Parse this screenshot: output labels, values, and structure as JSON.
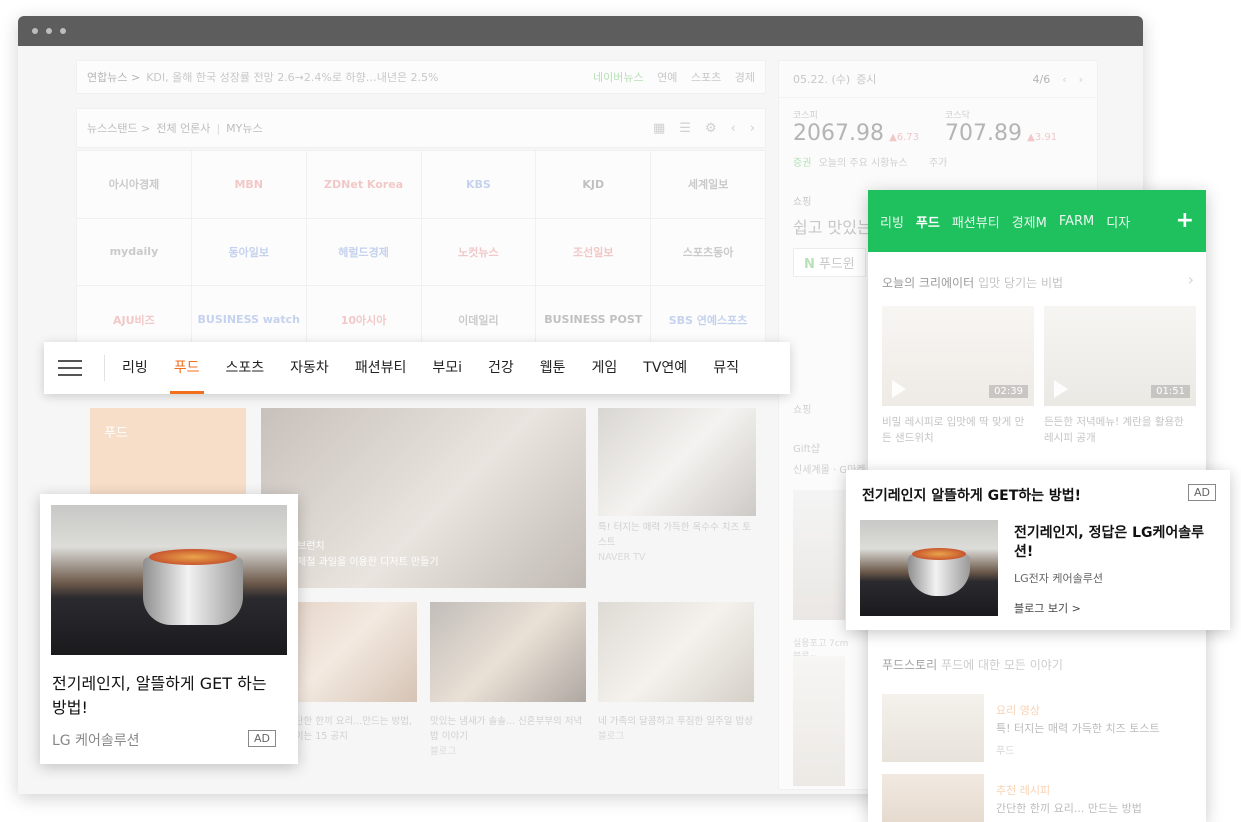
{
  "newsbar": {
    "source": "연합뉴스 >",
    "headline": "KDI, 올해 한국 성장률 전망 2.6→2.4%로 하향…내년은 2.5%",
    "tabs": [
      "네이버뉴스",
      "연예",
      "스포츠",
      "경제"
    ]
  },
  "newsstand": {
    "crumb1": "뉴스스탠드 >",
    "crumb2": "전체 언론사",
    "crumb3": "MY뉴스",
    "publishers": [
      "아시아경제",
      "MBN",
      "ZDNet Korea",
      "KBS",
      "KJD",
      "세계일보",
      "mydaily",
      "동아일보",
      "헤럴드경제",
      "노컷뉴스",
      "조선일보",
      "스포츠동아",
      "AJU비즈",
      "BUSINESS watch",
      "10아시아",
      "이데일리",
      "BUSINESS POST",
      "SBS 연예스포츠"
    ]
  },
  "finance": {
    "date": "05.22. (수)",
    "date_sub": "증시",
    "page": "4/6",
    "kospi_label": "코스피",
    "kospi_value": "2067.98",
    "kospi_change": "▲6.73",
    "kosdaq_label": "코스닥",
    "kosdaq_value": "707.89",
    "kosdaq_change": "▲3.91",
    "news_tag": "증권",
    "news_text": "오늘의 주요 시황뉴스",
    "search_label": "주가"
  },
  "shopping": {
    "label": "쇼핑",
    "title": "쉽고 맛있는",
    "btn_prefix": "N",
    "btn_text": "푸드윈",
    "side_label": "쇼핑",
    "side_lines": [
      "Gift샵",
      "신세계몰 · G마켓"
    ]
  },
  "catnav": {
    "tabs": [
      "리빙",
      "푸드",
      "스포츠",
      "자동차",
      "패션뷰티",
      "부모i",
      "건강",
      "웹툰",
      "게임",
      "TV연예",
      "뮤직"
    ],
    "active_index": 1
  },
  "content": {
    "food_label": "푸드",
    "main_cap1": "브런치",
    "main_cap2": "제철 과일을 이용한 디저트 만들기",
    "r1_title": "특! 터지는 매력 가득한 옥수수 치즈 토스트",
    "r1_src": "NAVER TV",
    "row2": [
      {
        "title": "간단한 한끼 요리...만드는 방법, 모이는 15 공지",
        "src": ""
      },
      {
        "title": "맛있는 냄새가 솔솔... 신혼부부의 저녁밥 이야기",
        "src": "블로그"
      },
      {
        "title": "네 가족의 달콤하고 푸짐한 일주일 밥상",
        "src": "블로그"
      }
    ],
    "narrow_text": "실용포고 7cm 블루~"
  },
  "ad_left": {
    "title": "전기레인지, 알뜰하게 GET 하는 방법!",
    "advertiser": "LG 케어솔루션",
    "badge": "AD"
  },
  "mobile": {
    "tabs": [
      "리빙",
      "푸드",
      "패션뷰티",
      "경제M",
      "FARM",
      "디자"
    ],
    "active_index": 1,
    "plus": "+",
    "creator_title": "오늘의 크리에이터",
    "creator_sub": "입맛 당기는 비법",
    "videos": [
      {
        "duration": "02:39",
        "caption": "비밀 레시피로 입맛에 딱 맞게 만든 샌드위치"
      },
      {
        "duration": "01:51",
        "caption": "든든한 저녁메뉴! 계란을 활용한 레시피 공개"
      }
    ],
    "story_title": "푸드스토리",
    "story_sub": "푸드에 대한 모든 이야기",
    "stories": [
      {
        "tag": "요리 영상",
        "title": "특! 터지는 매력 가득한 치즈 토스트",
        "src": "푸드"
      },
      {
        "tag": "추천 레시피",
        "title": "간단한 한끼 요리... 만드는 방법",
        "src": ""
      }
    ]
  },
  "ad_right": {
    "title": "전기레인지 알뜰하게 GET하는 방법!",
    "badge": "AD",
    "headline": "전기레인지, 정답은 LG케어솔루션!",
    "advertiser": "LG전자 케어솔루션",
    "more": "블로그 보기 >"
  }
}
